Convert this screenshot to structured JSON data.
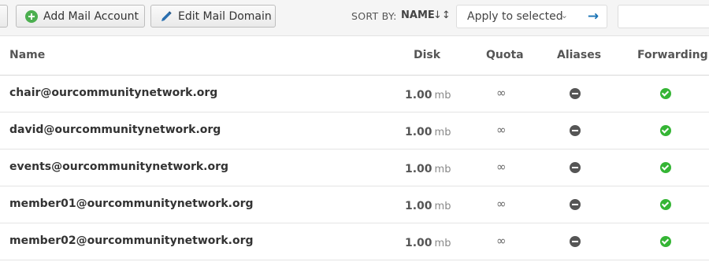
{
  "toolbar": {
    "add_mail_account_label": "Add Mail Account",
    "edit_mail_domain_label": "Edit Mail Domain",
    "sort_by_label": "SORT BY:",
    "sort_by_value": "NAME",
    "sort_icon": "↓↕",
    "apply_select_label": "Apply to selected",
    "apply_chevron": "⌄",
    "apply_go_glyph": "→",
    "search_value": ""
  },
  "table": {
    "columns": {
      "name": "Name",
      "disk": "Disk",
      "quota": "Quota",
      "aliases": "Aliases",
      "forwarding": "Forwarding"
    },
    "rows": [
      {
        "name": "chair@ourcommunitynetwork.org",
        "disk": "1.00",
        "disk_unit": "mb",
        "quota": "∞",
        "aliases_icon": "minus-circle-icon",
        "forwarding_icon": "check-circle-icon"
      },
      {
        "name": "david@ourcommunitynetwork.org",
        "disk": "1.00",
        "disk_unit": "mb",
        "quota": "∞",
        "aliases_icon": "minus-circle-icon",
        "forwarding_icon": "check-circle-icon"
      },
      {
        "name": "events@ourcommunitynetwork.org",
        "disk": "1.00",
        "disk_unit": "mb",
        "quota": "∞",
        "aliases_icon": "minus-circle-icon",
        "forwarding_icon": "check-circle-icon"
      },
      {
        "name": "member01@ourcommunitynetwork.org",
        "disk": "1.00",
        "disk_unit": "mb",
        "quota": "∞",
        "aliases_icon": "minus-circle-icon",
        "forwarding_icon": "check-circle-icon"
      },
      {
        "name": "member02@ourcommunitynetwork.org",
        "disk": "1.00",
        "disk_unit": "mb",
        "quota": "∞",
        "aliases_icon": "minus-circle-icon",
        "forwarding_icon": "check-circle-icon"
      }
    ]
  },
  "colors": {
    "success": "#35b535",
    "add_icon": "#4caf50",
    "link": "#1a73b5",
    "neutral_icon": "#555555"
  }
}
